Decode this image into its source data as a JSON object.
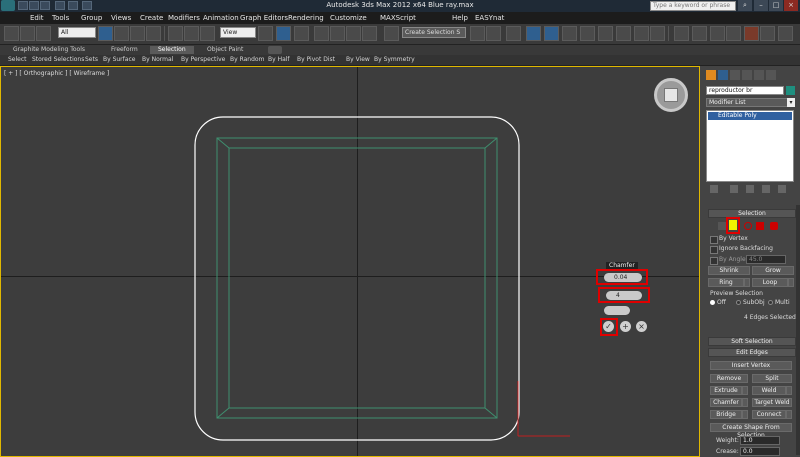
{
  "title_bar": {
    "title": "Autodesk 3ds Max  2012 x64      Blue ray.max",
    "search_placeholder": "Type a keyword or phrase"
  },
  "menu": [
    "Edit",
    "Tools",
    "Group",
    "Views",
    "Create",
    "Modifiers",
    "Animation",
    "Graph Editors",
    "Rendering",
    "Customize",
    "MAXScript",
    "Help",
    "EASYnat"
  ],
  "toolbar": {
    "filter_value": "All",
    "refcoord_value": "View",
    "named_selection_value": "Create Selection S"
  },
  "ribbon": {
    "tabs": [
      "Graphite Modeling Tools",
      "Freeform",
      "Selection",
      "Object Paint"
    ],
    "active_tab": "Selection",
    "items": [
      "Select",
      "Stored Selections",
      "Sets",
      "By Surface",
      "By Normal",
      "By Perspective",
      "By Random",
      "By Half",
      "By Pivot Dist",
      "By View",
      "By Symmetry"
    ]
  },
  "viewport": {
    "label": "[ + ] [ Orthographic ] [ Wireframe ]"
  },
  "caddy": {
    "title": "Chamfer",
    "amount": "0.04",
    "segments": "4"
  },
  "command_panel": {
    "object_name": "reproductor br",
    "modifier_list": "Modifier List",
    "stack_item": "Editable Poly",
    "selection": {
      "header": "Selection",
      "by_vertex": "By Vertex",
      "ignore_backfacing": "Ignore Backfacing",
      "by_angle": "By Angle:",
      "by_angle_value": "45.0",
      "shrink": "Shrink",
      "grow": "Grow",
      "ring": "Ring",
      "loop": "Loop",
      "preview_label": "Preview Selection",
      "preview_off": "Off",
      "preview_subobj": "SubObj",
      "preview_multi": "Multi",
      "status": "4 Edges Selected"
    },
    "soft_selection": {
      "header": "Soft Selection"
    },
    "edit_edges": {
      "header": "Edit Edges",
      "insert_vertex": "Insert Vertex",
      "remove": "Remove",
      "split": "Split",
      "extrude": "Extrude",
      "weld": "Weld",
      "chamfer": "Chamfer",
      "target_weld": "Target Weld",
      "bridge": "Bridge",
      "connect": "Connect",
      "create_shape": "Create Shape From Selection",
      "weight_label": "Weight:",
      "weight_value": "1.0",
      "crease_label": "Crease:",
      "crease_value": "0.0"
    }
  },
  "colors": {
    "highlight_red": "#e00000",
    "selection_green": "#3f8f6f",
    "active_edge_yellow": "#f2f200",
    "viewport_border": "#e0b800",
    "titlebar": "#1f2a36"
  }
}
